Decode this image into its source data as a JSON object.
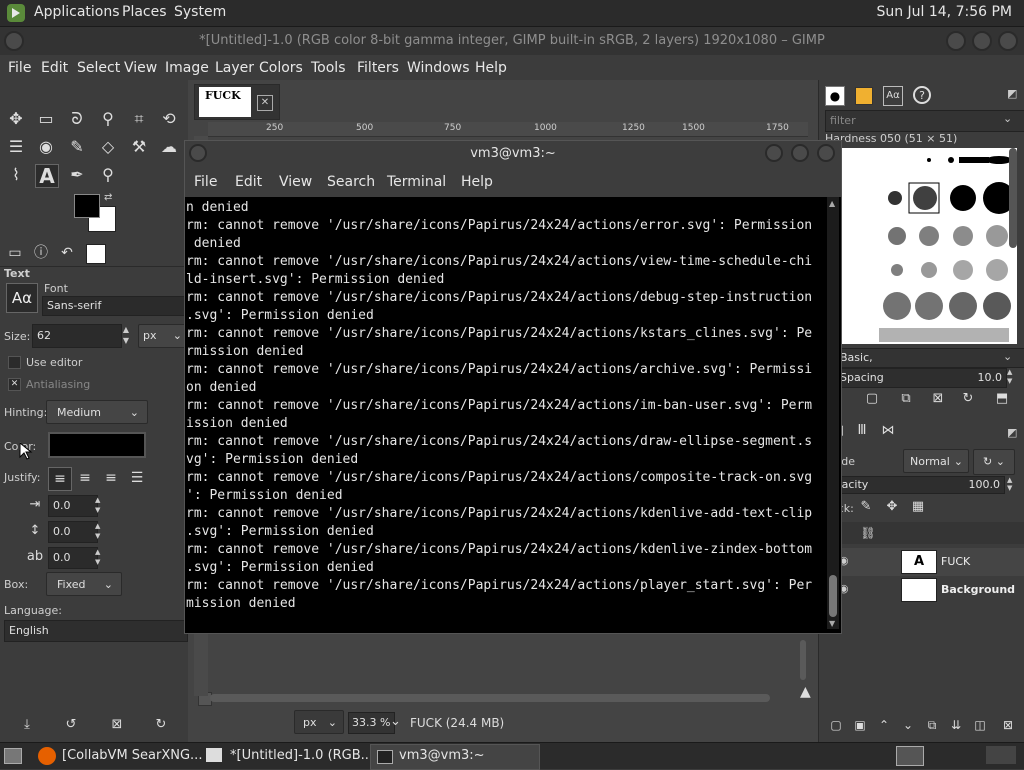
{
  "system_panel": {
    "menus": [
      "Applications",
      "Places",
      "System"
    ],
    "clock": "Sun Jul 14,  7:56 PM"
  },
  "gimp": {
    "title": "*[Untitled]-1.0 (RGB color 8-bit gamma integer, GIMP built-in sRGB, 2 layers) 1920x1080 – GIMP",
    "menu": [
      "File",
      "Edit",
      "Select",
      "View",
      "Image",
      "Layer",
      "Colors",
      "Tools",
      "Filters",
      "Windows",
      "Help"
    ],
    "image_tab_text": "FUCK",
    "ruler_ticks": [
      "250",
      "500",
      "750",
      "1000",
      "1250",
      "1500",
      "1750"
    ],
    "status": {
      "unit": "px",
      "zoom": "33.3 %",
      "info": "FUCK (24.4 MB)"
    }
  },
  "tool_options": {
    "section_label": "Text",
    "font_label": "Font",
    "font_preview": "Aα",
    "font_value": "Sans-serif",
    "size_label": "Size:",
    "size_value": "62",
    "size_unit": "px",
    "use_editor_label": "Use editor",
    "antialiasing_label": "Antialiasing",
    "hinting_label": "Hinting:",
    "hinting_value": "Medium",
    "color_label": "Color:",
    "color_value": "#000000",
    "justify_label": "Justify:",
    "indent_value": "0.0",
    "line_spacing_value": "0.0",
    "letter_spacing_value": "0.0",
    "box_label": "Box:",
    "box_value": "Fixed",
    "language_label": "Language:",
    "language_value": "English"
  },
  "dock": {
    "filter_placeholder": "filter",
    "brush_name": "Hardness 050 (51 × 51)",
    "brush_tag": "Basic,",
    "spacing_label": "Spacing",
    "spacing_value": "10.0",
    "mode_label": "Mode",
    "mode_value": "Normal",
    "opacity_label": "Opacity",
    "opacity_value": "100.0",
    "lock_label": "Lock:",
    "layers": [
      {
        "name": "FUCK",
        "type": "text"
      },
      {
        "name": "Background",
        "type": "image"
      }
    ]
  },
  "terminal": {
    "title": "vm3@vm3:~",
    "menu": [
      "File",
      "Edit",
      "View",
      "Search",
      "Terminal",
      "Help"
    ],
    "lines": [
      "n denied",
      "rm: cannot remove '/usr/share/icons/Papirus/24x24/actions/error.svg': Permission",
      " denied",
      "rm: cannot remove '/usr/share/icons/Papirus/24x24/actions/view-time-schedule-chi",
      "ld-insert.svg': Permission denied",
      "rm: cannot remove '/usr/share/icons/Papirus/24x24/actions/debug-step-instruction",
      ".svg': Permission denied",
      "rm: cannot remove '/usr/share/icons/Papirus/24x24/actions/kstars_clines.svg': Pe",
      "rmission denied",
      "rm: cannot remove '/usr/share/icons/Papirus/24x24/actions/archive.svg': Permissi",
      "on denied",
      "rm: cannot remove '/usr/share/icons/Papirus/24x24/actions/im-ban-user.svg': Perm",
      "ission denied",
      "rm: cannot remove '/usr/share/icons/Papirus/24x24/actions/draw-ellipse-segment.s",
      "vg': Permission denied",
      "rm: cannot remove '/usr/share/icons/Papirus/24x24/actions/composite-track-on.svg",
      "': Permission denied",
      "rm: cannot remove '/usr/share/icons/Papirus/24x24/actions/kdenlive-add-text-clip",
      ".svg': Permission denied",
      "rm: cannot remove '/usr/share/icons/Papirus/24x24/actions/kdenlive-zindex-bottom",
      ".svg': Permission denied",
      "rm: cannot remove '/usr/share/icons/Papirus/24x24/actions/player_start.svg': Per",
      "mission denied"
    ]
  },
  "taskbar": {
    "items": [
      "[CollabVM SearXNG...",
      "*[Untitled]-1.0 (RGB...",
      "vm3@vm3:~"
    ]
  }
}
